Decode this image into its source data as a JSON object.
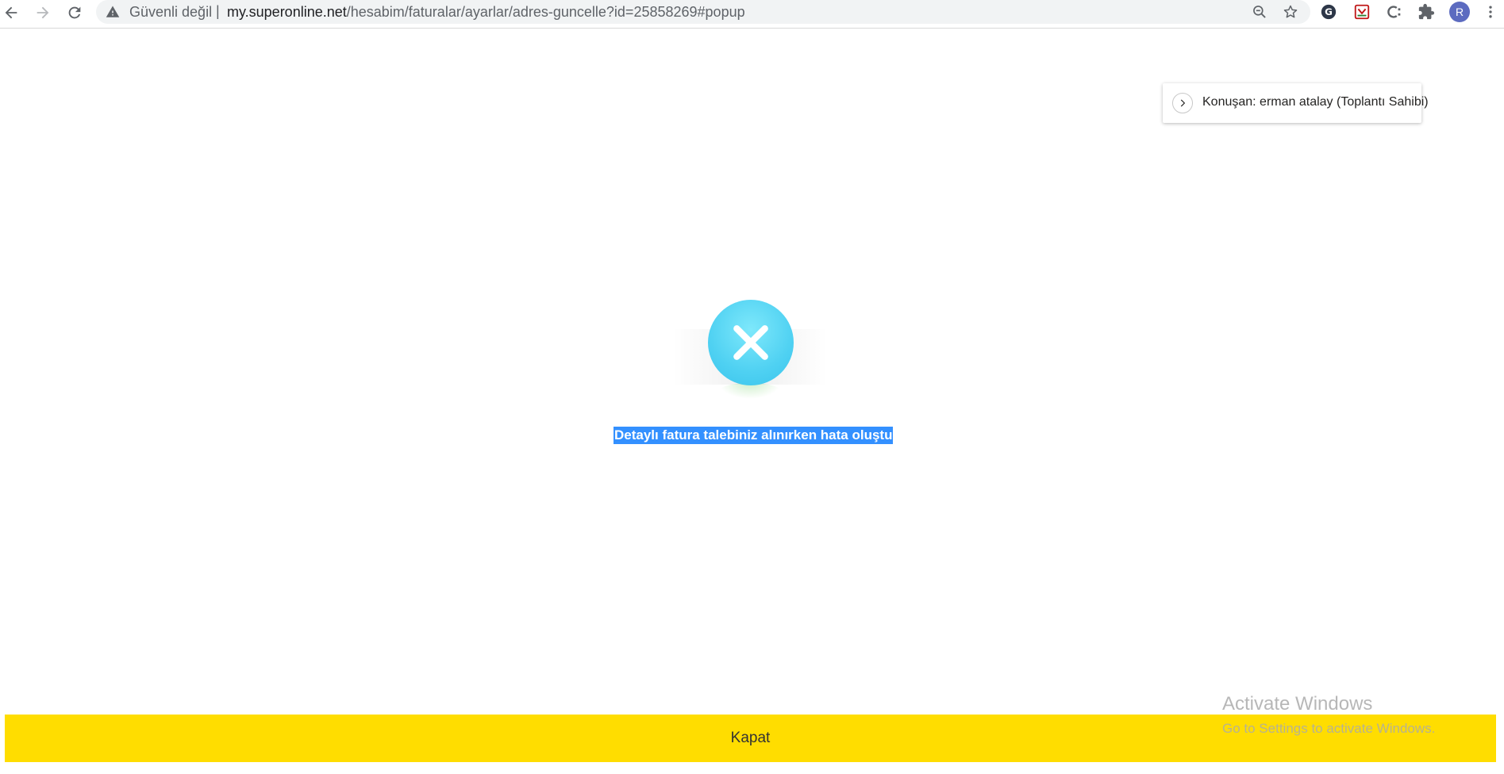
{
  "browser": {
    "security_label": "Güvenli değil",
    "separator": "|",
    "url_host": "my.superonline.net",
    "url_path": "/hesabim/faturalar/ayarlar/adres-guncelle?id=25858269#popup",
    "profile_initial": "R",
    "icons": [
      "back-icon",
      "forward-icon",
      "reload-icon",
      "warning-icon",
      "zoom-out-icon",
      "star-icon",
      "grammar-extension-icon",
      "mcafee-extension-icon",
      "c-extension-icon",
      "puzzle-icon",
      "menu-icon"
    ]
  },
  "speaker": {
    "text": "Konuşan: erman atalay (Toplantı Sahibi)",
    "icon": "chevron-right-icon"
  },
  "popup": {
    "icon": "error-x-icon",
    "icon_color": "#4fd1f2",
    "message": "Detaylı fatura talebiniz alınırken hata oluştu",
    "close_label": "Kapat",
    "close_color": "#ffdd00"
  },
  "watermark": {
    "title": "Activate Windows",
    "subtitle": "Go to Settings to activate Windows."
  }
}
